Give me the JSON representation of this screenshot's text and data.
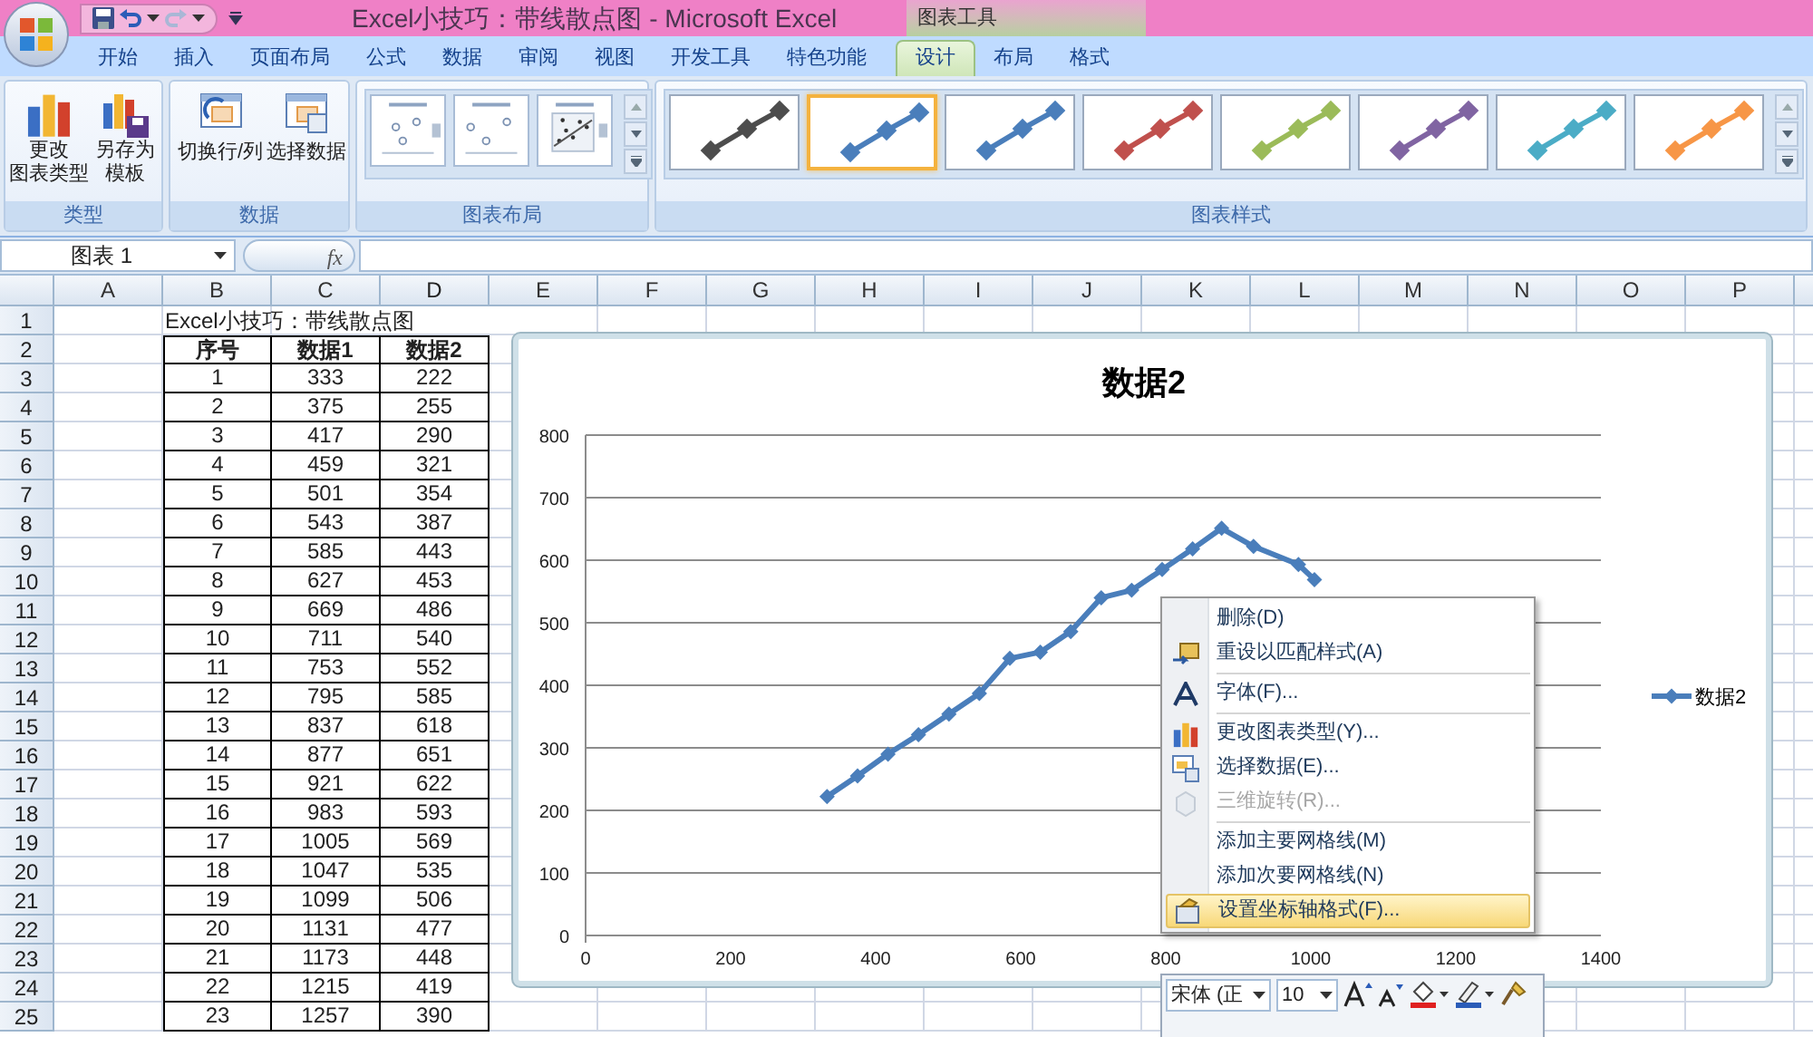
{
  "window": {
    "title": "Excel小技巧：带线散点图 - Microsoft Excel",
    "contextual_title": "图表工具"
  },
  "tabs": [
    {
      "label": "开始",
      "selected": false
    },
    {
      "label": "插入",
      "selected": false
    },
    {
      "label": "页面布局",
      "selected": false
    },
    {
      "label": "公式",
      "selected": false
    },
    {
      "label": "数据",
      "selected": false
    },
    {
      "label": "审阅",
      "selected": false
    },
    {
      "label": "视图",
      "selected": false
    },
    {
      "label": "开发工具",
      "selected": false
    },
    {
      "label": "特色功能",
      "selected": false
    }
  ],
  "contextual_tabs": [
    {
      "label": "设计",
      "selected": true
    },
    {
      "label": "布局",
      "selected": false
    },
    {
      "label": "格式",
      "selected": false
    }
  ],
  "ribbon": {
    "type_group": {
      "label": "类型",
      "buttons": [
        {
          "lines": [
            "更改",
            "图表类型"
          ]
        },
        {
          "lines": [
            "另存为",
            "模板"
          ]
        }
      ]
    },
    "data_group": {
      "label": "数据",
      "buttons": [
        "切换行/列",
        "选择数据"
      ]
    },
    "layout_group": {
      "label": "图表布局"
    },
    "style_group": {
      "label": "图表样式",
      "styles": [
        {
          "color": "#4d4d4d",
          "selected": false
        },
        {
          "color": "#4a7ebb",
          "selected": true
        },
        {
          "color": "#4a7ebb",
          "selected": false
        },
        {
          "color": "#c0504d",
          "selected": false
        },
        {
          "color": "#9bbb59",
          "selected": false
        },
        {
          "color": "#8064a2",
          "selected": false
        },
        {
          "color": "#4bacc6",
          "selected": false
        },
        {
          "color": "#f79646",
          "selected": false
        }
      ]
    }
  },
  "formula_bar": {
    "name_box": "图表 1",
    "fx": "fx"
  },
  "sheet": {
    "columns": [
      "A",
      "B",
      "C",
      "D",
      "E",
      "F",
      "G",
      "H",
      "I",
      "J",
      "K",
      "L",
      "M",
      "N",
      "O",
      "P"
    ],
    "rows": [
      "1",
      "2",
      "3",
      "4",
      "5",
      "6",
      "7",
      "8",
      "9",
      "10",
      "11",
      "12",
      "13",
      "14",
      "15",
      "16",
      "17",
      "18",
      "19",
      "20",
      "21",
      "22",
      "23",
      "24",
      "25"
    ],
    "title_cell": "Excel小技巧：带线散点图",
    "table": {
      "columns": [
        "序号",
        "数据1",
        "数据2"
      ],
      "rows": [
        [
          "1",
          "333",
          "222"
        ],
        [
          "2",
          "375",
          "255"
        ],
        [
          "3",
          "417",
          "290"
        ],
        [
          "4",
          "459",
          "321"
        ],
        [
          "5",
          "501",
          "354"
        ],
        [
          "6",
          "543",
          "387"
        ],
        [
          "7",
          "585",
          "443"
        ],
        [
          "8",
          "627",
          "453"
        ],
        [
          "9",
          "669",
          "486"
        ],
        [
          "10",
          "711",
          "540"
        ],
        [
          "11",
          "753",
          "552"
        ],
        [
          "12",
          "795",
          "585"
        ],
        [
          "13",
          "837",
          "618"
        ],
        [
          "14",
          "877",
          "651"
        ],
        [
          "15",
          "921",
          "622"
        ],
        [
          "16",
          "983",
          "593"
        ],
        [
          "17",
          "1005",
          "569"
        ],
        [
          "18",
          "1047",
          "535"
        ],
        [
          "19",
          "1099",
          "506"
        ],
        [
          "20",
          "1131",
          "477"
        ],
        [
          "21",
          "1173",
          "448"
        ],
        [
          "22",
          "1215",
          "419"
        ],
        [
          "23",
          "1257",
          "390"
        ]
      ]
    }
  },
  "chart": {
    "chart_data": {
      "type": "line",
      "title": "数据2",
      "x": [
        333,
        375,
        417,
        459,
        501,
        543,
        585,
        627,
        669,
        711,
        753,
        795,
        837,
        877,
        921,
        983,
        1005
      ],
      "series": [
        {
          "name": "数据2",
          "color": "#4a7ebb",
          "marker": "diamond",
          "values": [
            222,
            255,
            290,
            321,
            354,
            387,
            443,
            453,
            486,
            540,
            552,
            585,
            618,
            651,
            622,
            593,
            569
          ]
        }
      ],
      "grid": true,
      "xlim": [
        0,
        1400
      ],
      "ylim": [
        0,
        800
      ],
      "xticks": [
        0,
        200,
        400,
        600,
        800,
        1000,
        1200,
        1400
      ],
      "yticks": [
        0,
        100,
        200,
        300,
        400,
        500,
        600,
        700,
        800
      ]
    }
  },
  "context_menu": [
    {
      "label": "删除(D)",
      "disabled": false,
      "selected": false,
      "separator_after": false
    },
    {
      "label": "重设以匹配样式(A)",
      "disabled": false,
      "selected": false,
      "separator_after": true
    },
    {
      "label": "字体(F)...",
      "disabled": false,
      "selected": false,
      "separator_after": true
    },
    {
      "label": "更改图表类型(Y)...",
      "disabled": false,
      "selected": false,
      "separator_after": false
    },
    {
      "label": "选择数据(E)...",
      "disabled": false,
      "selected": false,
      "separator_after": false
    },
    {
      "label": "三维旋转(R)...",
      "disabled": true,
      "selected": false,
      "separator_after": true
    },
    {
      "label": "添加主要网格线(M)",
      "disabled": false,
      "selected": false,
      "separator_after": false
    },
    {
      "label": "添加次要网格线(N)",
      "disabled": false,
      "selected": false,
      "separator_after": false
    },
    {
      "label": "设置坐标轴格式(F)...",
      "disabled": false,
      "selected": true,
      "separator_after": false
    }
  ],
  "mini_toolbar": {
    "font": "宋体 (正",
    "size": "10"
  }
}
